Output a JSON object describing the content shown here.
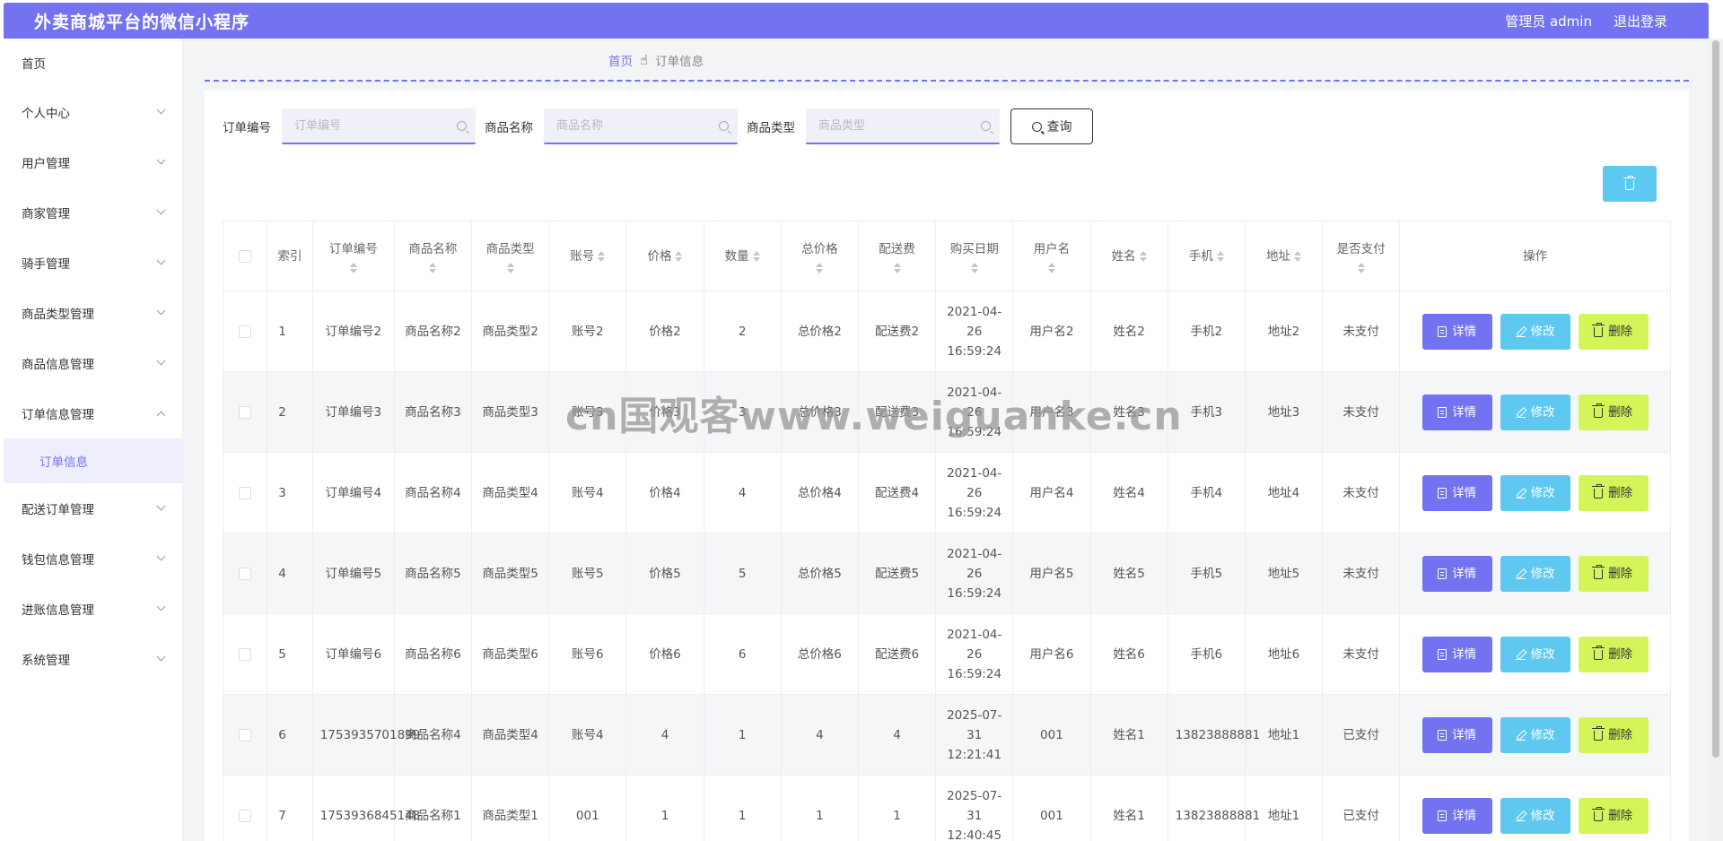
{
  "header": {
    "title": "外卖商城平台的微信小程序",
    "user_label": "管理员 admin",
    "logout_label": "退出登录"
  },
  "sidebar": {
    "home": "首页",
    "items": [
      {
        "label": "个人中心"
      },
      {
        "label": "用户管理"
      },
      {
        "label": "商家管理"
      },
      {
        "label": "骑手管理"
      },
      {
        "label": "商品类型管理"
      },
      {
        "label": "商品信息管理"
      },
      {
        "label": "订单信息管理"
      },
      {
        "label": "配送订单管理"
      },
      {
        "label": "钱包信息管理"
      },
      {
        "label": "进账信息管理"
      },
      {
        "label": "系统管理"
      }
    ],
    "active_sub": "订单信息"
  },
  "breadcrumb": {
    "home": "首页",
    "current": "订单信息"
  },
  "search": {
    "order_no_label": "订单编号",
    "order_no_placeholder": "订单编号",
    "product_name_label": "商品名称",
    "product_name_placeholder": "商品名称",
    "product_type_label": "商品类型",
    "product_type_placeholder": "商品类型",
    "query_label": "查询"
  },
  "table": {
    "headers": {
      "index": "索引",
      "order_no": "订单编号",
      "product_name": "商品名称",
      "product_type": "商品类型",
      "account": "账号",
      "price": "价格",
      "quantity": "数量",
      "total": "总价格",
      "delivery_fee": "配送费",
      "purchase_date": "购买日期",
      "username": "用户名",
      "name": "姓名",
      "phone": "手机",
      "address": "地址",
      "paid": "是否支付",
      "actions": "操作"
    },
    "rows": [
      {
        "index": "1",
        "order_no": "订单编号2",
        "product_name": "商品名称2",
        "product_type": "商品类型2",
        "account": "账号2",
        "price": "价格2",
        "quantity": "2",
        "total": "总价格2",
        "delivery_fee": "配送费2",
        "purchase_date": "2021-04-26 16:59:24",
        "username": "用户名2",
        "name": "姓名2",
        "phone": "手机2",
        "address": "地址2",
        "paid": "未支付"
      },
      {
        "index": "2",
        "order_no": "订单编号3",
        "product_name": "商品名称3",
        "product_type": "商品类型3",
        "account": "账号3",
        "price": "价格3",
        "quantity": "3",
        "total": "总价格3",
        "delivery_fee": "配送费3",
        "purchase_date": "2021-04-26 16:59:24",
        "username": "用户名3",
        "name": "姓名3",
        "phone": "手机3",
        "address": "地址3",
        "paid": "未支付"
      },
      {
        "index": "3",
        "order_no": "订单编号4",
        "product_name": "商品名称4",
        "product_type": "商品类型4",
        "account": "账号4",
        "price": "价格4",
        "quantity": "4",
        "total": "总价格4",
        "delivery_fee": "配送费4",
        "purchase_date": "2021-04-26 16:59:24",
        "username": "用户名4",
        "name": "姓名4",
        "phone": "手机4",
        "address": "地址4",
        "paid": "未支付"
      },
      {
        "index": "4",
        "order_no": "订单编号5",
        "product_name": "商品名称5",
        "product_type": "商品类型5",
        "account": "账号5",
        "price": "价格5",
        "quantity": "5",
        "total": "总价格5",
        "delivery_fee": "配送费5",
        "purchase_date": "2021-04-26 16:59:24",
        "username": "用户名5",
        "name": "姓名5",
        "phone": "手机5",
        "address": "地址5",
        "paid": "未支付"
      },
      {
        "index": "5",
        "order_no": "订单编号6",
        "product_name": "商品名称6",
        "product_type": "商品类型6",
        "account": "账号6",
        "price": "价格6",
        "quantity": "6",
        "total": "总价格6",
        "delivery_fee": "配送费6",
        "purchase_date": "2021-04-26 16:59:24",
        "username": "用户名6",
        "name": "姓名6",
        "phone": "手机6",
        "address": "地址6",
        "paid": "未支付"
      },
      {
        "index": "6",
        "order_no": "1753935701899",
        "product_name": "商品名称4",
        "product_type": "商品类型4",
        "account": "账号4",
        "price": "4",
        "quantity": "1",
        "total": "4",
        "delivery_fee": "4",
        "purchase_date": "2025-07-31 12:21:41",
        "username": "001",
        "name": "姓名1",
        "phone": "13823888881",
        "address": "地址1",
        "paid": "已支付"
      },
      {
        "index": "7",
        "order_no": "1753936845148",
        "product_name": "商品名称1",
        "product_type": "商品类型1",
        "account": "001",
        "price": "1",
        "quantity": "1",
        "total": "1",
        "delivery_fee": "1",
        "purchase_date": "2025-07-31 12:40:45",
        "username": "001",
        "name": "姓名1",
        "phone": "13823888881",
        "address": "地址1",
        "paid": "已支付"
      }
    ],
    "action_labels": {
      "detail": "详情",
      "edit": "修改",
      "delete": "删除"
    }
  },
  "watermark": "cn国观客www.weiguanke.cn",
  "colors": {
    "primary": "#7373f2",
    "edit": "#5fc8f0",
    "delete": "#d4f55a"
  }
}
